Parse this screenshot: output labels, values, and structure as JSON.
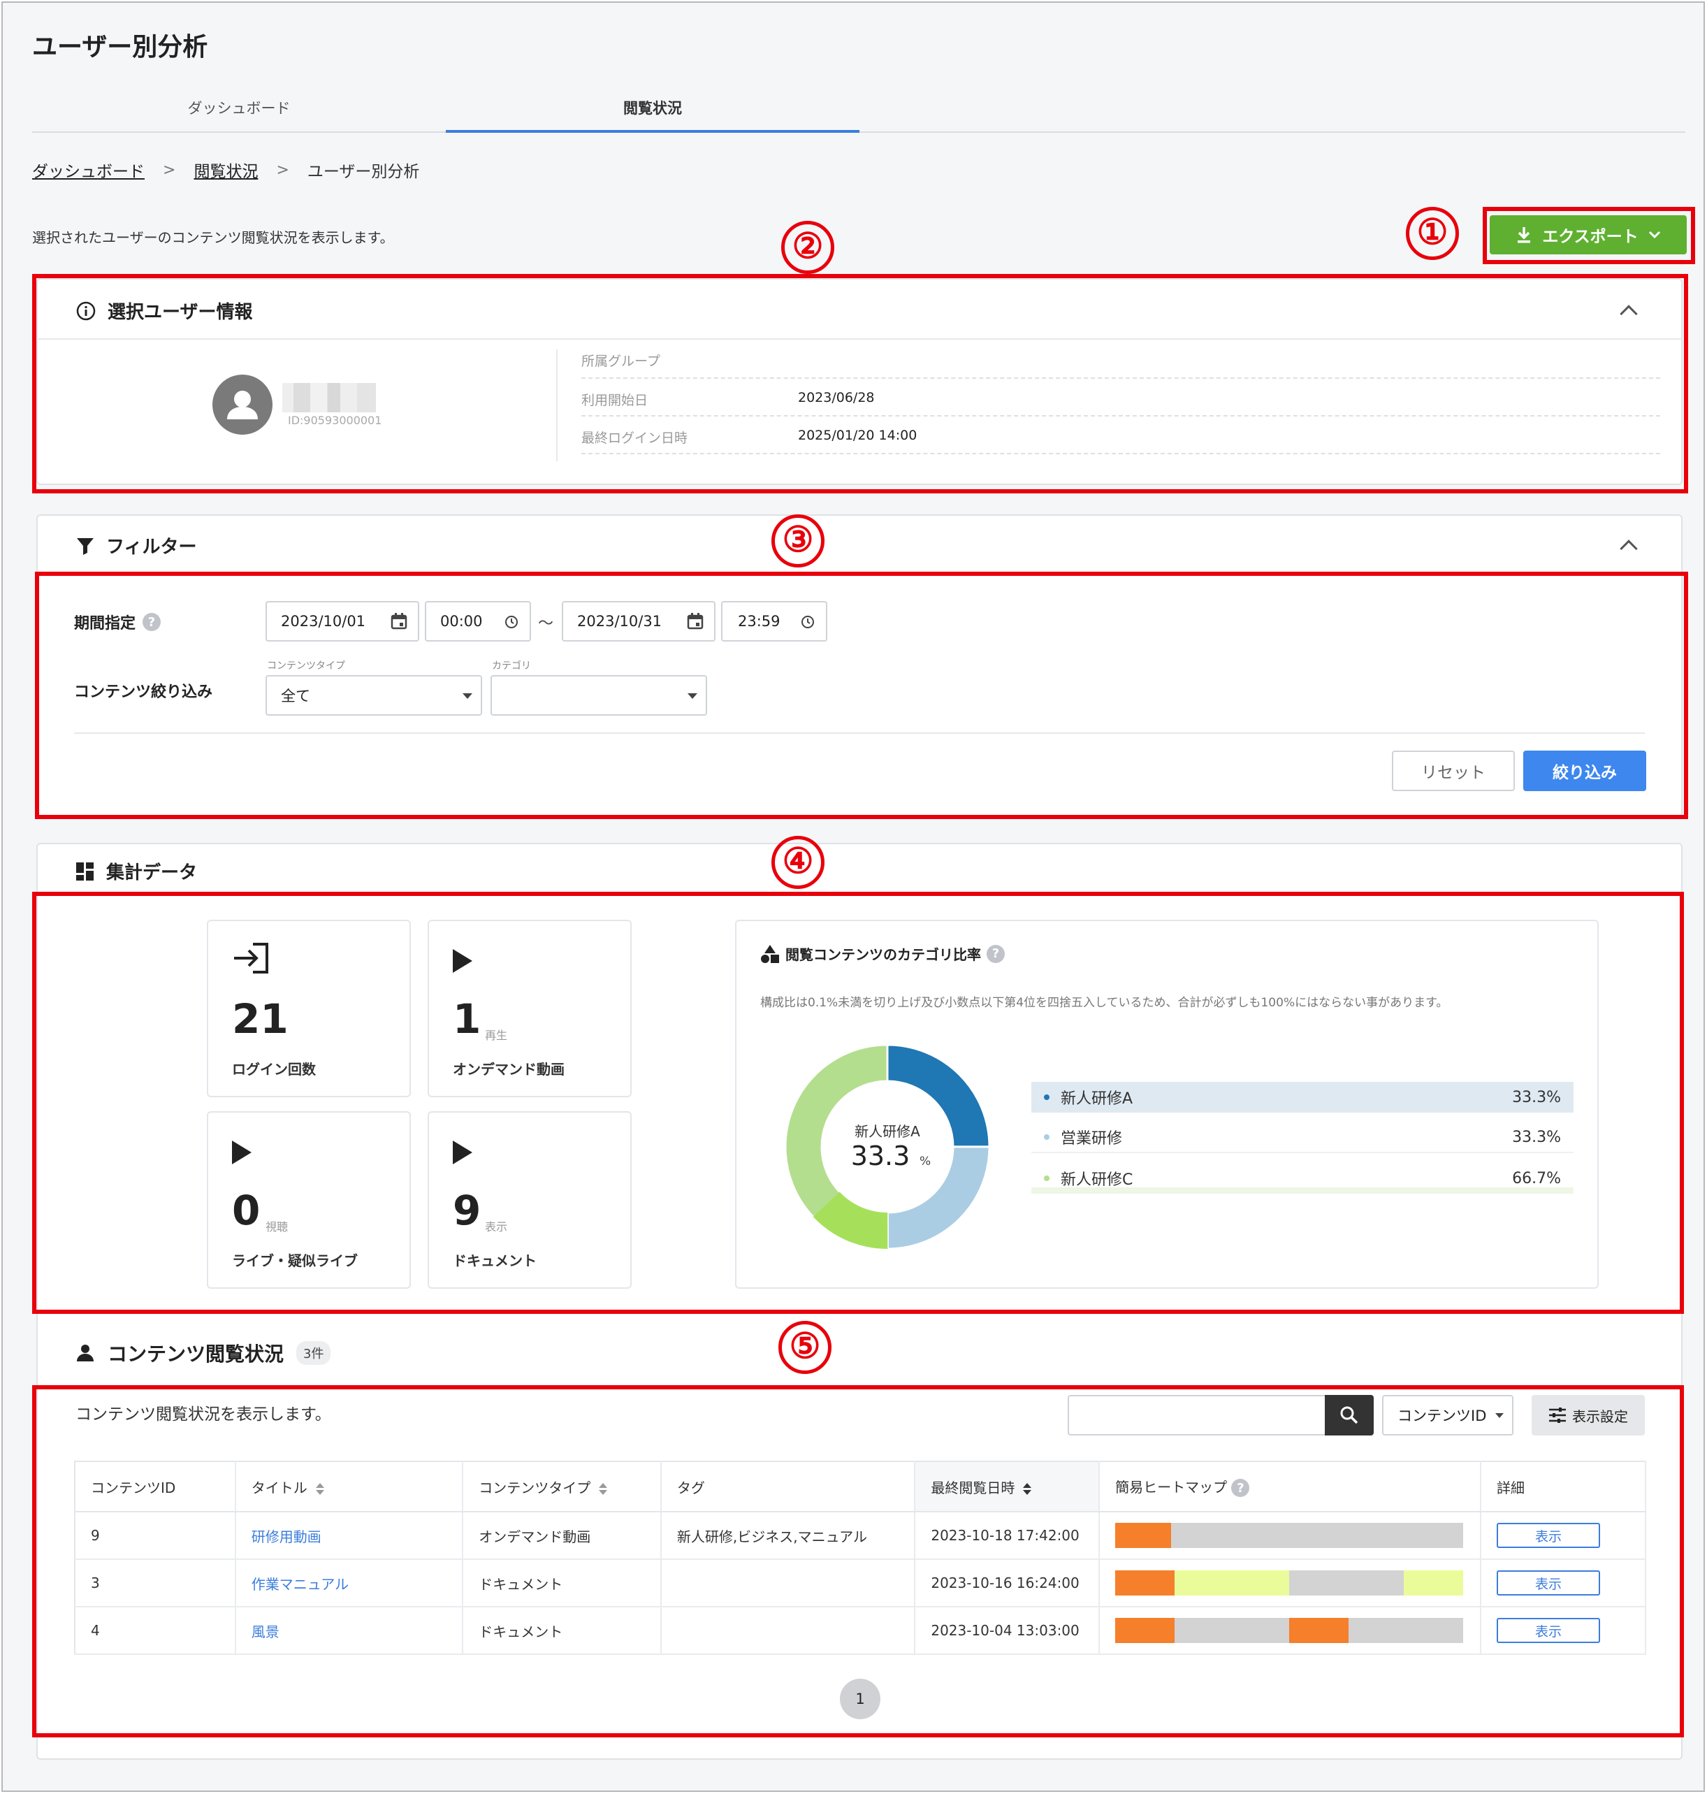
{
  "page": {
    "title": "ユーザー別分析"
  },
  "tabs": [
    {
      "label": "ダッシュボード"
    },
    {
      "label": "閲覧状況"
    }
  ],
  "breadcrumb": {
    "items": [
      "ダッシュボード",
      "閲覧状況",
      "ユーザー別分析"
    ],
    "separator": ">"
  },
  "description": "選択されたユーザーのコンテンツ閲覧状況を表示します。",
  "export": {
    "label": "エクスポート"
  },
  "markers": [
    "①",
    "②",
    "③",
    "④",
    "⑤"
  ],
  "user_info": {
    "title": "選択ユーザー情報",
    "user_id": "ID:90593000001",
    "rows": [
      {
        "label": "所属グループ",
        "value": ""
      },
      {
        "label": "利用開始日",
        "value": "2023/06/28"
      },
      {
        "label": "最終ログイン日時",
        "value": "2025/01/20 14:00"
      }
    ]
  },
  "filter": {
    "title": "フィルター",
    "period_label": "期間指定",
    "start_date": "2023/10/01",
    "start_time": "00:00",
    "tilde": "～",
    "end_date": "2023/10/31",
    "end_time": "23:59",
    "content_label": "コンテンツ絞り込み",
    "content_type_label": "コンテンツタイプ",
    "content_type_value": "全て",
    "category_label": "カテゴリ",
    "category_value": "",
    "reset_label": "リセット",
    "apply_label": "絞り込み"
  },
  "summary": {
    "title": "集計データ",
    "stats": [
      {
        "value": "21",
        "unit": "",
        "label": "ログイン回数",
        "icon": "login-icon"
      },
      {
        "value": "1",
        "unit": "再生",
        "label": "オンデマンド動画",
        "icon": "play-icon"
      },
      {
        "value": "0",
        "unit": "視聴",
        "label": "ライブ・疑似ライブ",
        "icon": "play-icon"
      },
      {
        "value": "9",
        "unit": "表示",
        "label": "ドキュメント",
        "icon": "play-icon"
      }
    ],
    "category_title": "閲覧コンテンツのカテゴリ比率",
    "category_note": "構成比は0.1%未満を切り上げ及び小数点以下第4位を四捨五入しているため、合計が必ずしも100%にはならない事があります。",
    "donut_center_label": "新人研修A",
    "donut_center_value": "33.3",
    "donut_center_unit": "%"
  },
  "chart_data": {
    "type": "pie",
    "categories": [
      "新人研修A",
      "営業研修",
      "新人研修C"
    ],
    "values": [
      33.3,
      33.3,
      66.7
    ],
    "value_labels": [
      "33.3%",
      "33.3%",
      "66.7%"
    ],
    "colors": [
      "#1f77b4",
      "#aacde3",
      "#b3de8e"
    ],
    "highlight_color": "#a6e05a",
    "legend_position": "right"
  },
  "content_status": {
    "title": "コンテンツ閲覧状況",
    "count": "3件",
    "description": "コンテンツ閲覧状況を表示します。",
    "search_placeholder": "",
    "search_field_value": "コンテンツID",
    "display_settings_label": "表示設定",
    "columns": [
      "コンテンツID",
      "タイトル",
      "コンテンツタイプ",
      "タグ",
      "最終閲覧日時",
      "簡易ヒートマップ",
      "詳細"
    ],
    "rows": [
      {
        "id": "9",
        "title": "研修用動画",
        "type": "オンデマンド動画",
        "tags": "新人研修,ビジネス,マニュアル",
        "last_viewed": "2023-10-18 17:42:00",
        "action": "表示",
        "heatmap": [
          {
            "w": 16,
            "c": "#f57f2a"
          },
          {
            "w": 84,
            "c": "#d3d3d3"
          }
        ]
      },
      {
        "id": "3",
        "title": "作業マニュアル",
        "type": "ドキュメント",
        "tags": "",
        "last_viewed": "2023-10-16 16:24:00",
        "action": "表示",
        "heatmap": [
          {
            "w": 17,
            "c": "#f57f2a"
          },
          {
            "w": 33,
            "c": "#eafc9a"
          },
          {
            "w": 33,
            "c": "#d3d3d3"
          },
          {
            "w": 17,
            "c": "#eafc9a"
          }
        ]
      },
      {
        "id": "4",
        "title": "風景",
        "type": "ドキュメント",
        "tags": "",
        "last_viewed": "2023-10-04 13:03:00",
        "action": "表示",
        "heatmap": [
          {
            "w": 17,
            "c": "#f57f2a"
          },
          {
            "w": 33,
            "c": "#d3d3d3"
          },
          {
            "w": 17,
            "c": "#f57f2a"
          },
          {
            "w": 33,
            "c": "#d3d3d3"
          }
        ]
      }
    ],
    "page": "1"
  },
  "colors": {
    "accent": "#3b7ddd",
    "export_green": "#5fb030",
    "annotation_red": "#e8000b",
    "primary_button": "#3d87ee"
  }
}
